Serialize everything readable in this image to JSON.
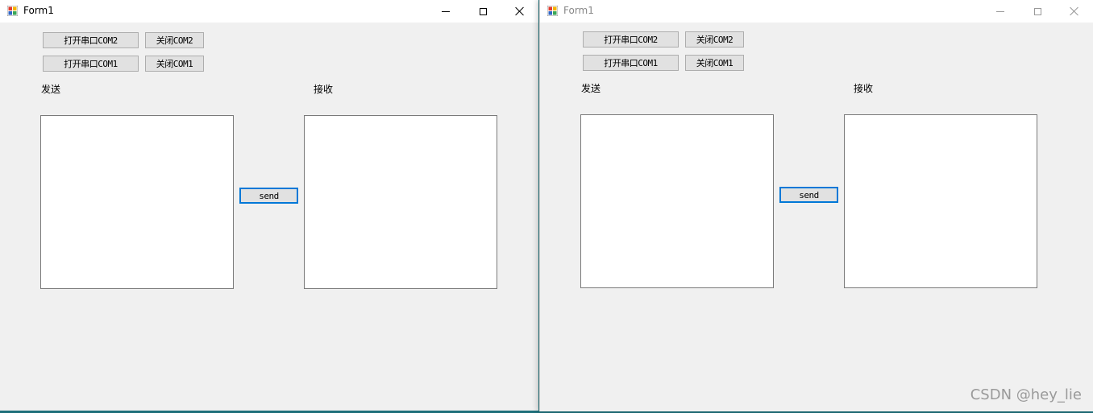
{
  "windows": [
    {
      "title": "Form1",
      "buttons": {
        "open_com2": "打开串口COM2",
        "close_com2": "关闭COM2",
        "open_com1": "打开串口COM1",
        "close_com1": "关闭COM1",
        "send": "send"
      },
      "labels": {
        "send": "发送",
        "receive": "接收"
      },
      "textboxes": {
        "send": "",
        "receive": ""
      }
    },
    {
      "title": "Form1",
      "buttons": {
        "open_com2": "打开串口COM2",
        "close_com2": "关闭COM2",
        "open_com1": "打开串口COM1",
        "close_com1": "关闭COM1",
        "send": "send"
      },
      "labels": {
        "send": "发送",
        "receive": "接收"
      },
      "textboxes": {
        "send": "",
        "receive": ""
      }
    }
  ],
  "icons": {
    "app": "winforms-app-icon",
    "minimize": "minimize-icon",
    "maximize": "maximize-icon",
    "close": "close-icon"
  },
  "colors": {
    "form_bg": "#f0f0f0",
    "titlebar_bg": "#ffffff",
    "focus_border": "#0078d7",
    "desktop": "#1e6f7a"
  },
  "watermark": "CSDN @hey_lie"
}
